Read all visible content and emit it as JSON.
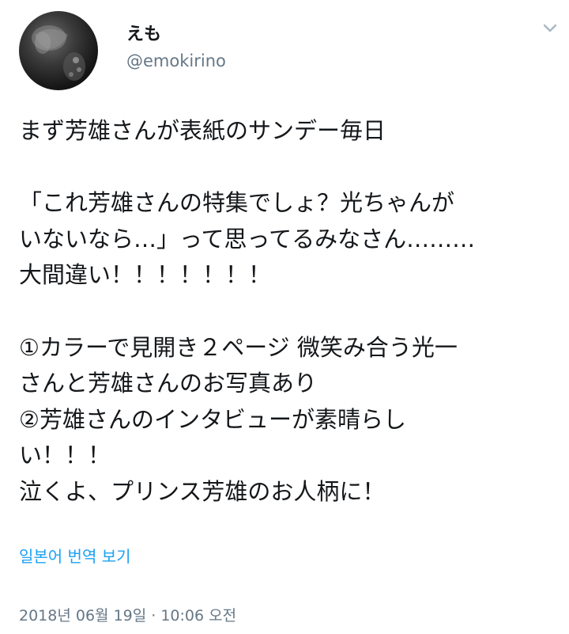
{
  "user": {
    "display_name": "えも",
    "handle": "@emokirino"
  },
  "tweet": {
    "lines": [
      "まず芳雄さんが表紙のサンデー毎日",
      "",
      "「これ芳雄さんの特集でしょ？光ちゃんが",
      "いないなら…」って思ってるみなさん………",
      "大間違い！！！！！！！",
      "",
      "①カラーで見開き２ページ 微笑み合う光一",
      "さんと芳雄さんのお写真あり",
      "②芳雄さんのインタビューが素晴らし",
      "い！！！",
      "泣くよ、プリンス芳雄のお人柄に！"
    ],
    "translate_label": "일본어 번역 보기",
    "timestamp": "2018년 06월 19일 · 10:06 오전"
  },
  "colors": {
    "text": "#14171a",
    "secondary": "#657786",
    "link": "#1da1f2",
    "caret": "#aab8c2"
  },
  "icons": {
    "caret": "chevron-down-icon",
    "avatar": "avatar"
  }
}
